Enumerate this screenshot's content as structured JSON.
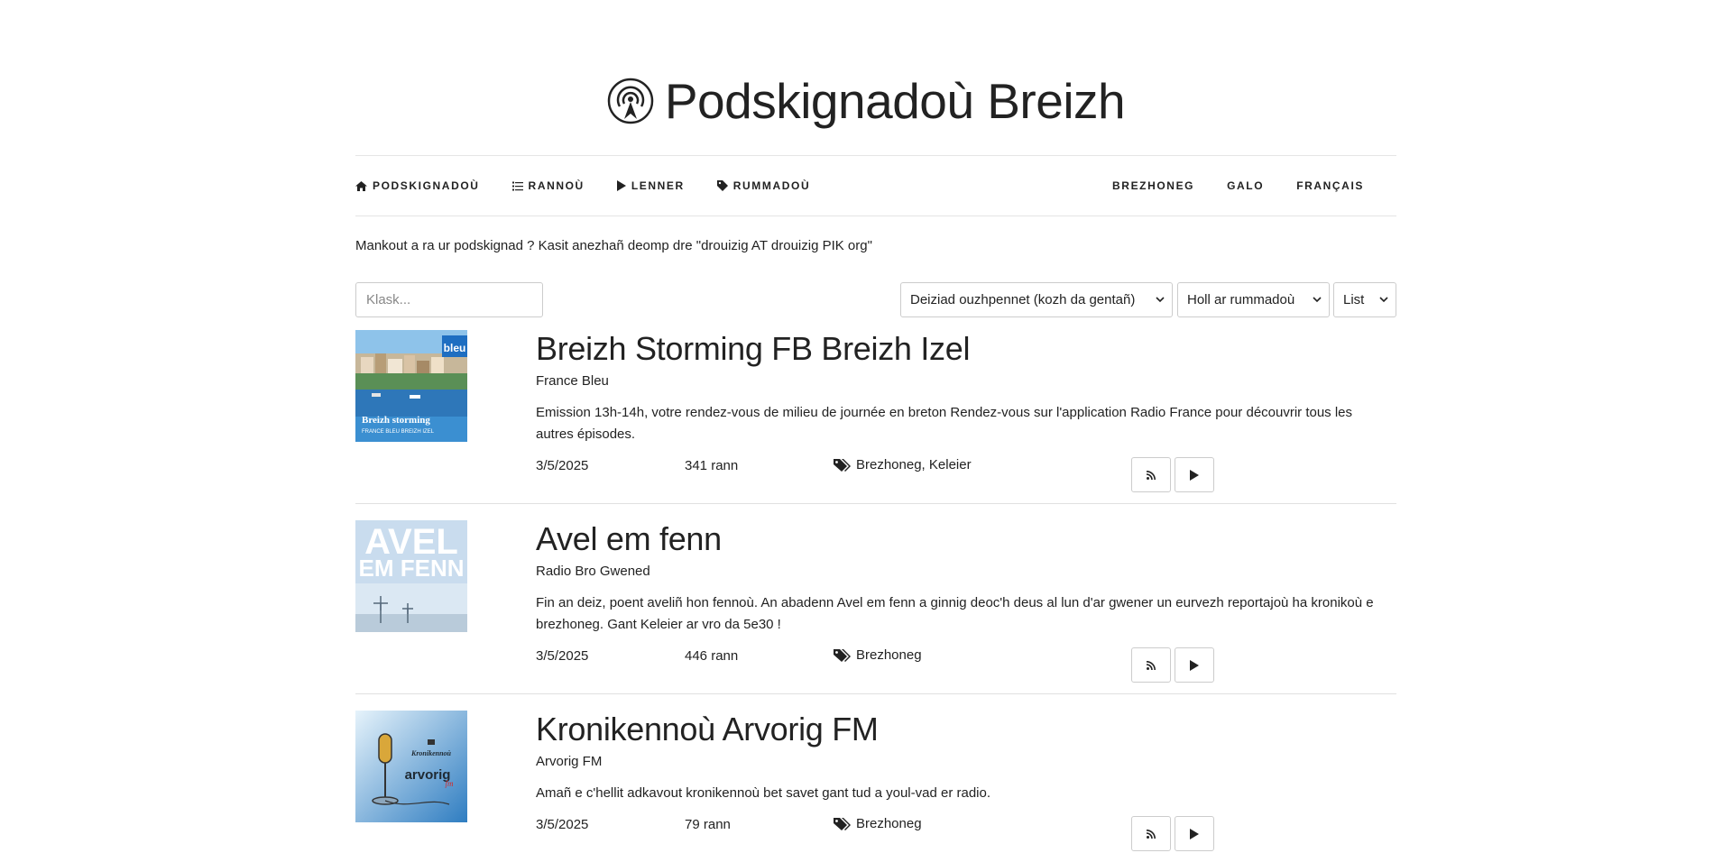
{
  "site": {
    "title": "Podskignadoù Breizh"
  },
  "nav": {
    "left": [
      {
        "label": "PODSKIGNADOÙ",
        "icon": "home-icon"
      },
      {
        "label": "RANNOÙ",
        "icon": "list-icon"
      },
      {
        "label": "LENNER",
        "icon": "play-icon"
      },
      {
        "label": "RUMMADOÙ",
        "icon": "tag-icon"
      }
    ],
    "languages": [
      {
        "label": "BREZHONEG"
      },
      {
        "label": "GALO"
      },
      {
        "label": "FRANÇAIS"
      }
    ]
  },
  "notice": "Mankout a ra ur podskignad ? Kasit anezhañ deomp dre \"drouizig AT drouizig PIK org\"",
  "filters": {
    "search_placeholder": "Klask...",
    "order_selected": "Deiziad ouzhpennet (kozh da gentañ)",
    "category_selected": "Holl ar rummadoù",
    "view_selected": "List"
  },
  "podcasts": [
    {
      "title": "Breizh Storming FB Breizh Izel",
      "author": "France Bleu",
      "description": "Emission 13h-14h, votre rendez-vous de milieu de journée en breton Rendez-vous sur l'application Radio France pour découvrir tous les autres épisodes.",
      "date": "3/5/2025",
      "episodes": "341 rann",
      "tags": "Brezhoneg, Keleier",
      "thumb": {
        "brand": "bleu",
        "caption": "Breizh storming",
        "subcaption": "FRANCE BLEU BREIZH IZEL"
      }
    },
    {
      "title": "Avel em fenn",
      "author": "Radio Bro Gwened",
      "description": "Fin an deiz, poent aveliñ hon fennoù. An abadenn Avel em fenn a ginnig deoc'h deus al lun d'ar gwener un eurvezh reportajoù ha kronikoù e brezhoneg. Gant Keleier ar vro da 5e30 !",
      "date": "3/5/2025",
      "episodes": "446 rann",
      "tags": "Brezhoneg",
      "thumb": {
        "line1": "AVEL",
        "line2": "EM FENN"
      }
    },
    {
      "title": "Kronikennoù Arvorig FM",
      "author": "Arvorig FM",
      "description": "Amañ e c'hellit adkavout kronikennoù bet savet gant tud a youl-vad er radio.",
      "date": "3/5/2025",
      "episodes": "79 rann",
      "tags": "Brezhoneg",
      "thumb": {
        "line1": "Kronikennoù",
        "brand": "arvorig",
        "brand_suffix": "fm"
      }
    }
  ]
}
